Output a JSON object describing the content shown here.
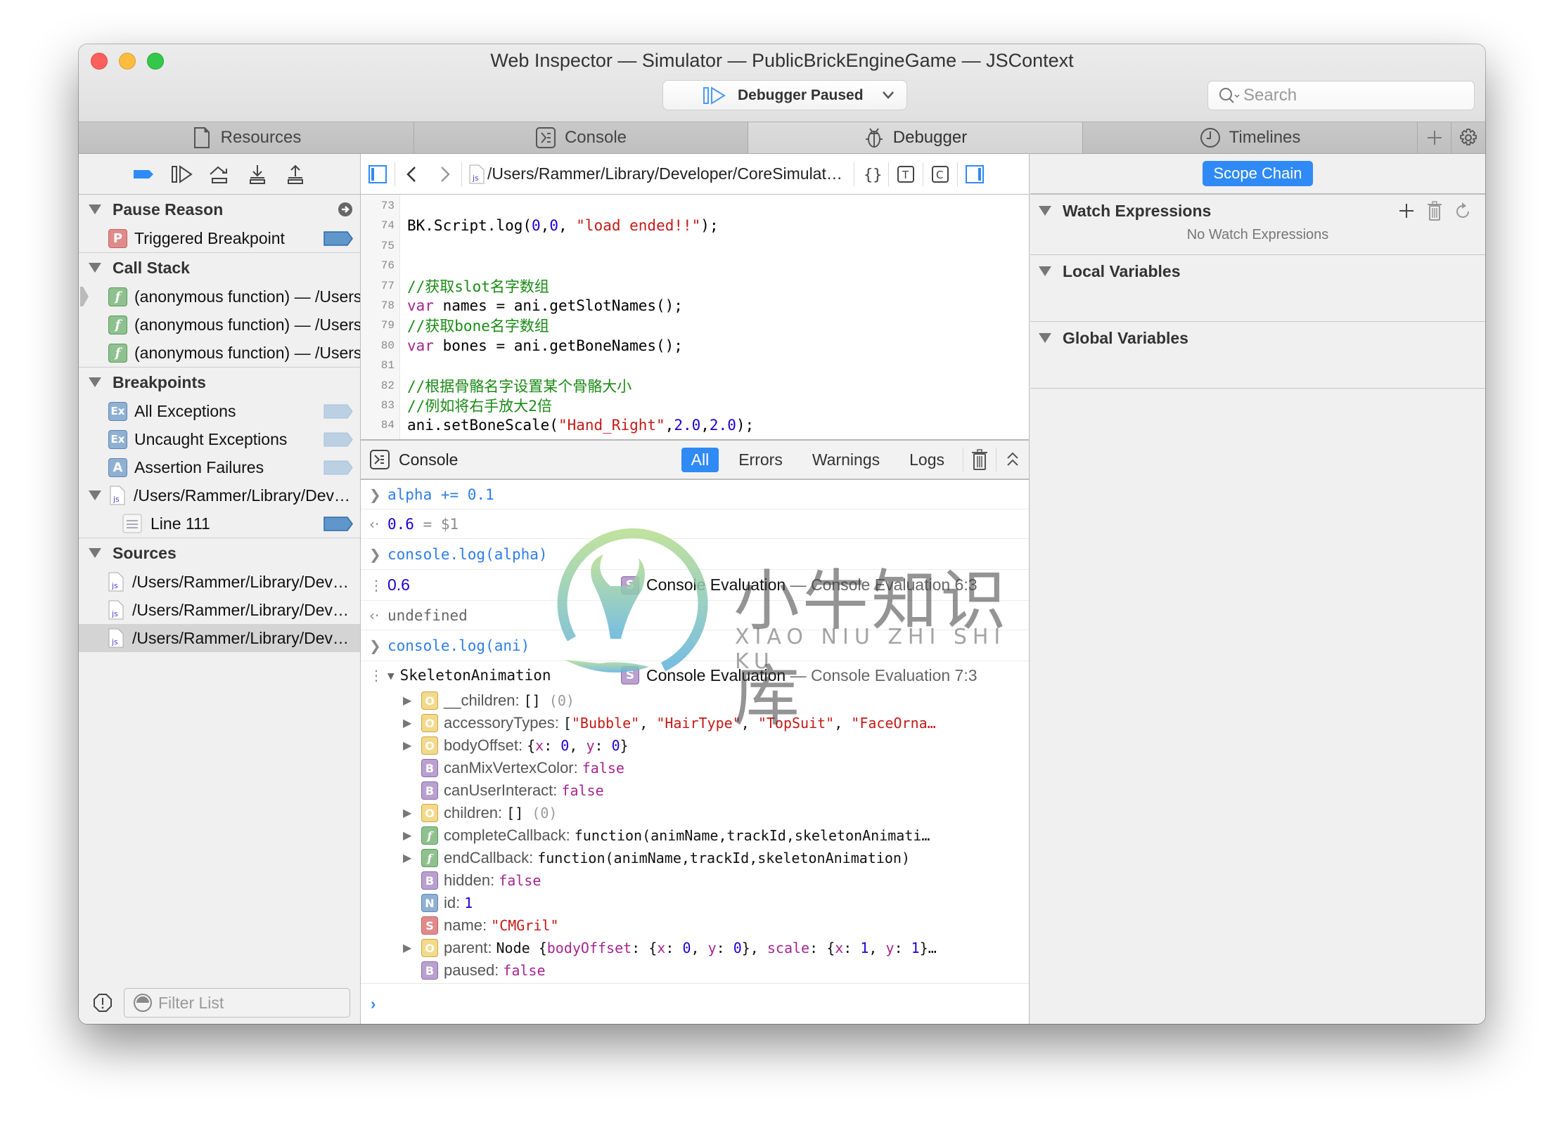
{
  "window": {
    "title": "Web Inspector — Simulator — PublicBrickEngineGame — JSContext",
    "status_button": "Debugger Paused",
    "search_placeholder": "Search"
  },
  "tabs": [
    {
      "label": "Resources",
      "icon": "document-icon",
      "active": false
    },
    {
      "label": "Console",
      "icon": "console-icon",
      "active": false
    },
    {
      "label": "Debugger",
      "icon": "bug-icon",
      "active": true
    },
    {
      "label": "Timelines",
      "icon": "clock-icon",
      "active": false
    }
  ],
  "navigation": {
    "pause_reason": {
      "title": "Pause Reason",
      "item": "Triggered Breakpoint",
      "badge": "P"
    },
    "call_stack": {
      "title": "Call Stack",
      "frames": [
        "(anonymous function) — /Users/Rammer/",
        "(anonymous function) — /Users/Rammer/",
        "(anonymous function) — /Users/Rammer/"
      ],
      "badge": "f"
    },
    "breakpoints": {
      "title": "Breakpoints",
      "items": [
        {
          "label": "All Exceptions",
          "badge": "Ex"
        },
        {
          "label": "Uncaught Exceptions",
          "badge": "Ex"
        },
        {
          "label": "Assertion Failures",
          "badge": "A"
        }
      ],
      "file": "/Users/Rammer/Library/Dev…",
      "line": "Line 111"
    },
    "sources": {
      "title": "Sources",
      "files": [
        "/Users/Rammer/Library/Dev…",
        "/Users/Rammer/Library/Dev…",
        "/Users/Rammer/Library/Dev…"
      ],
      "selected_index": 2
    },
    "filter_placeholder": "Filter List"
  },
  "editor": {
    "path": "/Users/Rammer/Library/Developer/CoreSimulat…",
    "lines": [
      {
        "n": "73",
        "parts": []
      },
      {
        "n": "74",
        "parts": [
          [
            "",
            "BK.Script.log("
          ],
          [
            "num",
            "0"
          ],
          [
            "",
            ","
          ],
          [
            "num",
            "0"
          ],
          [
            "",
            ", "
          ],
          [
            "str",
            "\"load ended!!\""
          ],
          [
            "",
            ");"
          ]
        ]
      },
      {
        "n": "75",
        "parts": []
      },
      {
        "n": "76",
        "parts": []
      },
      {
        "n": "77",
        "parts": [
          [
            "com",
            "//获取slot名字数组"
          ]
        ]
      },
      {
        "n": "78",
        "parts": [
          [
            "kw",
            "var"
          ],
          [
            "",
            " names = ani.getSlotNames();"
          ]
        ]
      },
      {
        "n": "79",
        "parts": [
          [
            "com",
            "//获取bone名字数组"
          ]
        ]
      },
      {
        "n": "80",
        "parts": [
          [
            "kw",
            "var"
          ],
          [
            "",
            " bones = ani.getBoneNames();"
          ]
        ]
      },
      {
        "n": "81",
        "parts": []
      },
      {
        "n": "82",
        "parts": [
          [
            "com",
            "//根据骨骼名字设置某个骨骼大小"
          ]
        ]
      },
      {
        "n": "83",
        "parts": [
          [
            "com",
            "//例如将右手放大2倍"
          ]
        ]
      },
      {
        "n": "84",
        "parts": [
          [
            "",
            "ani.setBoneScale("
          ],
          [
            "str",
            "\"Hand_Right\""
          ],
          [
            "",
            ","
          ],
          [
            "num",
            "2.0"
          ],
          [
            "",
            ","
          ],
          [
            "num",
            "2.0"
          ],
          [
            "",
            ");"
          ]
        ]
      },
      {
        "n": "85",
        "parts": []
      }
    ]
  },
  "console": {
    "title": "Console",
    "filters": [
      "All",
      "Errors",
      "Warnings",
      "Logs"
    ],
    "active_filter": "All",
    "messages": {
      "m1_input": "alpha += 0.1",
      "m2_value": "0.6",
      "m2_saved": " = $1",
      "m3_input": "console.log(alpha)",
      "m4_value": "0.6",
      "m4_loc": "Console Evaluation",
      "m4_loc_sub": " — Console Evaluation 6:3",
      "m5_value": "undefined",
      "m6_input": "console.log(ani)",
      "m7_object": "SkeletonAnimation",
      "m7_loc": "Console Evaluation",
      "m7_loc_sub": " — Console Evaluation 7:3"
    },
    "properties": [
      {
        "badge": "O",
        "expandable": true,
        "name": "__children:",
        "value": "[]",
        "vtype": "obj",
        "extra": " (0)"
      },
      {
        "badge": "O",
        "expandable": true,
        "name": "accessoryTypes:",
        "value_parts": [
          [
            "obj",
            "["
          ],
          [
            "str",
            "\"Bubble\""
          ],
          [
            "obj",
            ", "
          ],
          [
            "str",
            "\"HairType\""
          ],
          [
            "obj",
            ", "
          ],
          [
            "str",
            "\"TopSuit\""
          ],
          [
            "obj",
            ", "
          ],
          [
            "str",
            "\"FaceOrna…"
          ]
        ]
      },
      {
        "badge": "O",
        "expandable": true,
        "name": "bodyOffset:",
        "value_parts": [
          [
            "obj",
            "{"
          ],
          [
            "bool",
            "x"
          ],
          [
            "obj",
            ": "
          ],
          [
            "num",
            "0"
          ],
          [
            "obj",
            ", "
          ],
          [
            "bool",
            "y"
          ],
          [
            "obj",
            ": "
          ],
          [
            "num",
            "0"
          ],
          [
            "obj",
            "}"
          ]
        ]
      },
      {
        "badge": "B",
        "expandable": false,
        "name": "canMixVertexColor:",
        "value": "false",
        "vtype": "bool"
      },
      {
        "badge": "B",
        "expandable": false,
        "name": "canUserInteract:",
        "value": "false",
        "vtype": "bool"
      },
      {
        "badge": "O",
        "expandable": true,
        "name": "children:",
        "value": "[]",
        "vtype": "obj",
        "extra": " (0)"
      },
      {
        "badge": "f",
        "expandable": true,
        "name": "completeCallback:",
        "value": "function(animName,trackId,skeletonAnimati…",
        "vtype": "obj"
      },
      {
        "badge": "f",
        "expandable": true,
        "name": "endCallback:",
        "value": "function(animName,trackId,skeletonAnimation)",
        "vtype": "obj"
      },
      {
        "badge": "B",
        "expandable": false,
        "name": "hidden:",
        "value": "false",
        "vtype": "bool"
      },
      {
        "badge": "N",
        "expandable": false,
        "name": "id:",
        "value": "1",
        "vtype": "num"
      },
      {
        "badge": "S",
        "expandable": false,
        "name": "name:",
        "value": "\"CMGril\"",
        "vtype": "str"
      },
      {
        "badge": "O",
        "expandable": true,
        "name": "parent:",
        "value_parts": [
          [
            "obj",
            "Node {"
          ],
          [
            "bool",
            "bodyOffset"
          ],
          [
            "obj",
            ": {"
          ],
          [
            "bool",
            "x"
          ],
          [
            "obj",
            ": "
          ],
          [
            "num",
            "0"
          ],
          [
            "obj",
            ", "
          ],
          [
            "bool",
            "y"
          ],
          [
            "obj",
            ": "
          ],
          [
            "num",
            "0"
          ],
          [
            "obj",
            "}, "
          ],
          [
            "bool",
            "scale"
          ],
          [
            "obj",
            ": {"
          ],
          [
            "bool",
            "x"
          ],
          [
            "obj",
            ": "
          ],
          [
            "num",
            "1"
          ],
          [
            "obj",
            ", "
          ],
          [
            "bool",
            "y"
          ],
          [
            "obj",
            ": "
          ],
          [
            "num",
            "1"
          ],
          [
            "obj",
            "}…"
          ]
        ]
      },
      {
        "badge": "B",
        "expandable": false,
        "name": "paused:",
        "value": "false",
        "vtype": "bool"
      }
    ],
    "prompt_value": ""
  },
  "details": {
    "scope_chain_label": "Scope Chain",
    "watch": {
      "title": "Watch Expressions",
      "empty": "No Watch Expressions"
    },
    "local": {
      "title": "Local Variables"
    },
    "global": {
      "title": "Global Variables"
    }
  },
  "watermark": {
    "cn": "小牛知识库",
    "en": "XIAO NIU ZHI SHI KU"
  },
  "colors": {
    "accent": "#2f8af5",
    "breakpoint_active": "#6096c9",
    "breakpoint_inactive": "#bcd0e4",
    "string": "#c41a16",
    "keyword": "#a5258f",
    "number": "#1c00cf",
    "comment": "#1a8a14"
  }
}
